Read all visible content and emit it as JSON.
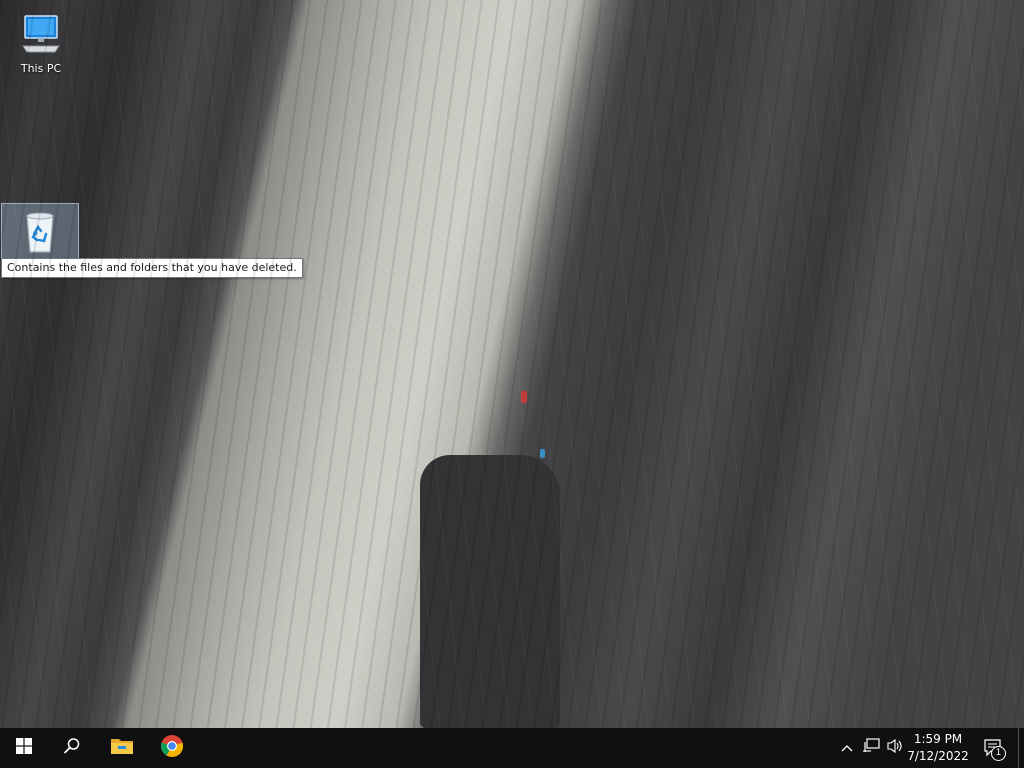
{
  "desktop": {
    "icons": [
      {
        "label": "This PC"
      },
      {
        "label": ""
      }
    ],
    "tooltip": "Contains the files and folders that you have deleted."
  },
  "taskbar": {
    "start_icon": "windows-logo-icon",
    "search_icon": "search-icon",
    "pinned": [
      {
        "name": "file-explorer",
        "icon": "folder-icon"
      },
      {
        "name": "google-chrome",
        "icon": "chrome-icon"
      }
    ],
    "tray": {
      "show_hidden_icon": "chevron-up-icon",
      "network_icon": "network-icon",
      "volume_icon": "speaker-icon",
      "time": "1:59 PM",
      "date": "7/12/2022",
      "notifications_count": "1"
    }
  },
  "colors": {
    "taskbar_bg": "#101010",
    "accent_blue": "#2b8de3",
    "tooltip_bg": "#ffffff"
  }
}
